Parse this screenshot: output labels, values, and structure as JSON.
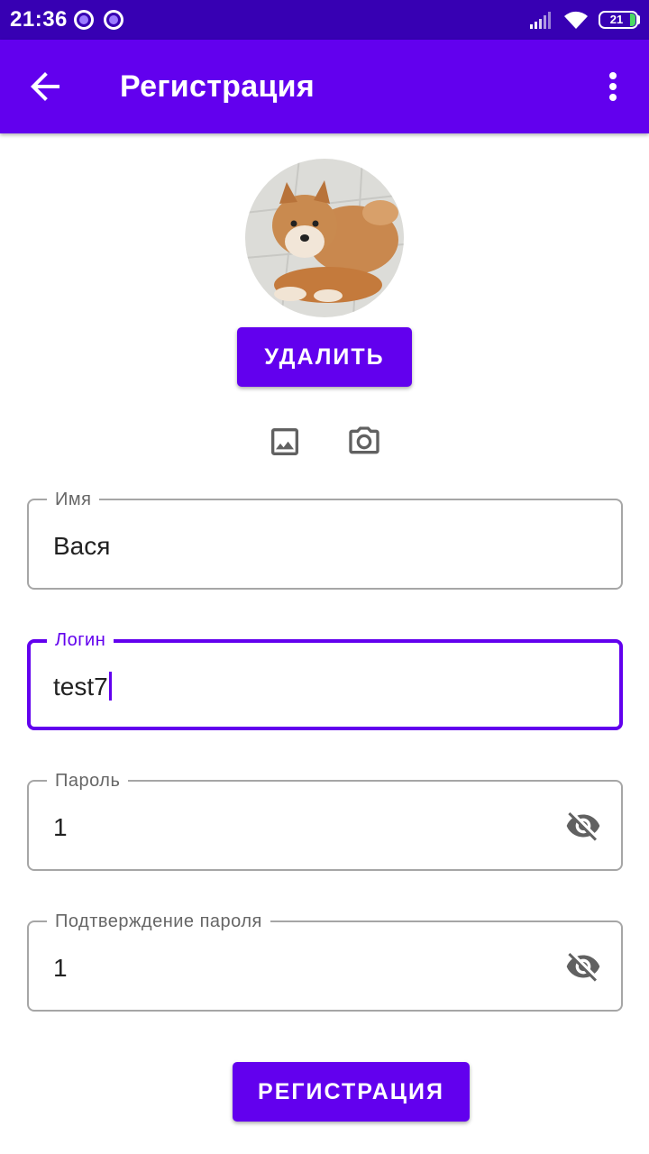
{
  "status_bar": {
    "time": "21:36",
    "battery_level": "21"
  },
  "app_bar": {
    "title": "Регистрация"
  },
  "profile": {
    "delete_label": "УДАЛИТЬ"
  },
  "form": {
    "name": {
      "label": "Имя",
      "value": "Вася"
    },
    "login": {
      "label": "Логин",
      "value": "test7"
    },
    "password": {
      "label": "Пароль",
      "value": "1"
    },
    "password_confirm": {
      "label": "Подтверждение пароля",
      "value": "1"
    }
  },
  "register_label": "РЕГИСТРАЦИЯ",
  "colors": {
    "primary": "#6200ee",
    "primary_dark": "#3700b3",
    "outline": "#a6a6a6",
    "icon_gray": "#616161"
  }
}
